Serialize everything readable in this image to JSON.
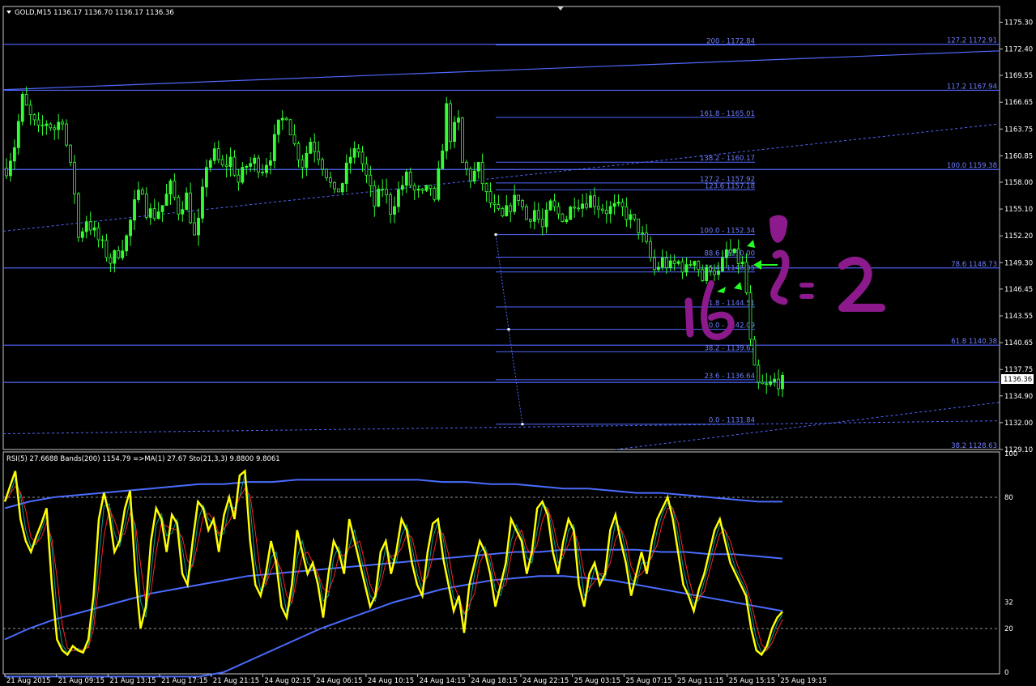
{
  "symbol_header": "GOLD,M15  1136.17 1136.70 1136.17 1136.36",
  "indicator_header": "RSI(5) 27.6688  Bands(200) 1154.79  =>MA(1) 27.67  Sto(21,3,3) 9.8800 9.8061",
  "current_price_label": "1136.36",
  "colors": {
    "background": "#000000",
    "frame": "#c8c8c8",
    "bull_candle": "#33ff33",
    "level_line": "#5068ff",
    "level_text": "#6f7fff",
    "rsi": "#ffff00",
    "stoch_main": "#00a0a0",
    "stoch_signal": "#ff2222",
    "band": "#4a6cff",
    "annotation_purple": "#8c1a8c",
    "arrow_green": "#22ff22"
  },
  "annotations": {
    "ratio_text": "1:2",
    "tp_number": "2",
    "sl_number": "1"
  },
  "chart_data": [
    {
      "type": "candlestick",
      "title": "GOLD,M15",
      "ylim": [
        1129.1,
        1177.0
      ],
      "y_ticks": [
        "1175.30",
        "1172.40",
        "1169.55",
        "1166.65",
        "1163.75",
        "1160.85",
        "1158.00",
        "1155.10",
        "1152.20",
        "1149.30",
        "1146.45",
        "1143.55",
        "1140.65",
        "1137.75",
        "1134.90",
        "1132.00",
        "1129.10"
      ],
      "x_ticks": [
        "21 Aug 2015",
        "21 Aug 09:15",
        "21 Aug 13:15",
        "21 Aug 17:15",
        "21 Aug 21:15",
        "24 Aug 02:15",
        "24 Aug 06:15",
        "24 Aug 10:15",
        "24 Aug 14:15",
        "24 Aug 18:15",
        "24 Aug 22:15",
        "25 Aug 03:15",
        "25 Aug 07:15",
        "25 Aug 11:15",
        "25 Aug 15:15",
        "25 Aug 19:15"
      ],
      "close_path": [
        [
          0,
          1159.5
        ],
        [
          2,
          1162
        ],
        [
          4,
          1167
        ],
        [
          6,
          1165
        ],
        [
          8,
          1163.5
        ],
        [
          10,
          1164.5
        ],
        [
          12,
          1163.8
        ],
        [
          14,
          1165
        ],
        [
          15,
          1162
        ],
        [
          17,
          1157
        ],
        [
          18,
          1152
        ],
        [
          20,
          1154
        ],
        [
          22,
          1152.5
        ],
        [
          24,
          1151
        ],
        [
          26,
          1149.5
        ],
        [
          28,
          1150.5
        ],
        [
          30,
          1152
        ],
        [
          32,
          1155.5
        ],
        [
          34,
          1157.5
        ],
        [
          35,
          1155
        ],
        [
          37,
          1154.5
        ],
        [
          39,
          1155.5
        ],
        [
          41,
          1157.5
        ],
        [
          43,
          1155
        ],
        [
          45,
          1156.5
        ],
        [
          47,
          1152
        ],
        [
          48,
          1153.5
        ],
        [
          50,
          1160
        ],
        [
          52,
          1161
        ],
        [
          54,
          1159.5
        ],
        [
          56,
          1160.5
        ],
        [
          58,
          1158
        ],
        [
          60,
          1159.8
        ],
        [
          62,
          1160.2
        ],
        [
          64,
          1159.5
        ],
        [
          66,
          1161
        ],
        [
          68,
          1164
        ],
        [
          70,
          1165.5
        ],
        [
          72,
          1162
        ],
        [
          74,
          1160
        ],
        [
          76,
          1162.5
        ],
        [
          78,
          1161
        ],
        [
          80,
          1159
        ],
        [
          82,
          1156.5
        ],
        [
          84,
          1158
        ],
        [
          86,
          1160.8
        ],
        [
          88,
          1161.5
        ],
        [
          90,
          1158.5
        ],
        [
          92,
          1155.5
        ],
        [
          94,
          1157.5
        ],
        [
          96,
          1155
        ],
        [
          98,
          1157
        ],
        [
          100,
          1158.5
        ],
        [
          102,
          1157
        ],
        [
          104,
          1156.5
        ],
        [
          106,
          1157.5
        ],
        [
          107,
          1155.5
        ],
        [
          109,
          1162
        ],
        [
          110,
          1166
        ],
        [
          111,
          1163
        ],
        [
          113,
          1164.5
        ],
        [
          114,
          1160
        ],
        [
          116,
          1158.5
        ],
        [
          118,
          1159.5
        ],
        [
          120,
          1156.5
        ],
        [
          122,
          1155
        ],
        [
          124,
          1154
        ],
        [
          126,
          1155.5
        ],
        [
          128,
          1156.5
        ],
        [
          130,
          1154
        ],
        [
          132,
          1155
        ],
        [
          134,
          1153
        ],
        [
          136,
          1155.5
        ],
        [
          138,
          1154.5
        ],
        [
          140,
          1154.2
        ],
        [
          142,
          1156
        ],
        [
          144,
          1155.8
        ],
        [
          146,
          1156.3
        ],
        [
          148,
          1155.5
        ],
        [
          150,
          1155
        ],
        [
          152,
          1155.2
        ],
        [
          154,
          1155
        ],
        [
          156,
          1154
        ],
        [
          158,
          1153
        ],
        [
          160,
          1151
        ],
        [
          162,
          1148.5
        ],
        [
          164,
          1149.5
        ],
        [
          166,
          1148.8
        ],
        [
          168,
          1149.3
        ],
        [
          170,
          1148.5
        ],
        [
          172,
          1150
        ],
        [
          174,
          1147.5
        ],
        [
          176,
          1149
        ],
        [
          178,
          1148
        ],
        [
          180,
          1150.5
        ],
        [
          182,
          1150
        ],
        [
          184,
          1149
        ],
        [
          185,
          1146
        ],
        [
          186,
          1140.5
        ],
        [
          187,
          1137.5
        ],
        [
          188,
          1136
        ],
        [
          190,
          1135.8
        ],
        [
          192,
          1136.5
        ],
        [
          194,
          1136.36
        ]
      ]
    },
    {
      "type": "line",
      "title": "RSI(5) / Bands(200) / Sto(21,3,3)",
      "ylim": [
        0,
        100
      ],
      "y_ticks": [
        "100",
        "80",
        "32",
        "20",
        "0"
      ],
      "levels": [
        80,
        20
      ],
      "series": [
        {
          "name": "RSI(5)",
          "values": [
            78,
            85,
            92,
            70,
            60,
            55,
            62,
            68,
            75,
            40,
            15,
            10,
            8,
            12,
            10,
            9,
            15,
            35,
            70,
            82,
            72,
            55,
            60,
            75,
            83,
            45,
            20,
            30,
            60,
            75,
            70,
            55,
            72,
            68,
            45,
            40,
            60,
            78,
            75,
            65,
            70,
            55,
            72,
            80,
            70,
            90,
            92,
            60,
            40,
            35,
            45,
            60,
            50,
            30,
            25,
            40,
            65,
            55,
            45,
            50,
            40,
            25,
            45,
            60,
            55,
            45,
            70,
            60,
            50,
            40,
            30,
            35,
            55,
            60,
            45,
            55,
            70,
            65,
            50,
            40,
            35,
            55,
            68,
            70,
            52,
            40,
            28,
            35,
            18,
            40,
            50,
            60,
            55,
            45,
            30,
            40,
            50,
            70,
            65,
            60,
            45,
            55,
            75,
            78,
            72,
            55,
            45,
            60,
            70,
            65,
            40,
            30,
            45,
            50,
            40,
            45,
            65,
            72,
            60,
            50,
            35,
            45,
            55,
            45,
            60,
            70,
            75,
            80,
            70,
            55,
            40,
            35,
            28,
            38,
            45,
            55,
            65,
            70,
            60,
            50,
            45,
            40,
            35,
            20,
            10,
            8,
            12,
            20,
            25,
            27.67
          ]
        },
        {
          "name": "Bands upper",
          "values": [
            75,
            78,
            80,
            81,
            82,
            83,
            84,
            85,
            86,
            86,
            87,
            87,
            88,
            88,
            88,
            88,
            88,
            88,
            87,
            87,
            86,
            86,
            85,
            84,
            84,
            83,
            82,
            82,
            81,
            80,
            79,
            78,
            78
          ]
        },
        {
          "name": "Bands middle",
          "values": [
            15,
            20,
            24,
            27,
            30,
            33,
            36,
            38,
            40,
            42,
            44,
            45,
            46,
            47,
            48,
            49,
            50,
            51,
            52,
            53,
            54,
            55,
            55,
            56,
            56,
            56,
            56,
            55,
            55,
            54,
            54,
            53,
            52
          ]
        },
        {
          "name": "Bands lower",
          "values": [
            -40,
            -38,
            -35,
            -30,
            -25,
            -20,
            -15,
            -10,
            -5,
            0,
            5,
            10,
            15,
            20,
            24,
            28,
            32,
            35,
            38,
            40,
            42,
            43,
            44,
            44,
            43,
            42,
            40,
            38,
            36,
            34,
            32,
            30,
            28
          ]
        }
      ]
    }
  ],
  "levels": {
    "h_lines": [
      {
        "price": 1172.91,
        "right_label": "127.2  1172.91"
      },
      {
        "price": 1167.94,
        "right_label": "117.2  1167.94"
      },
      {
        "price": 1159.38,
        "right_label": "100.0   1159.38"
      },
      {
        "price": 1148.73,
        "right_label": "78.6  1148.73"
      },
      {
        "price": 1140.38,
        "right_label": "61.8  1140.38"
      },
      {
        "price": 1136.36,
        "right_label": ""
      }
    ],
    "fib_levels": [
      {
        "price": 1172.84,
        "label": "200 - 1172.84"
      },
      {
        "price": 1165.01,
        "label": "161.8 - 1165.01"
      },
      {
        "price": 1160.17,
        "label": "138.2 - 1160.17"
      },
      {
        "price": 1157.92,
        "label": "127.2 - 1157.92"
      },
      {
        "price": 1157.18,
        "label": "123.6  1157.18"
      },
      {
        "price": 1152.34,
        "label": "100.0 - 1152.34"
      },
      {
        "price": 1149.9,
        "label": "88.6 - 1150.00"
      },
      {
        "price": 1148.3,
        "label": "76.4 - 1148.05"
      },
      {
        "price": 1144.51,
        "label": "61.8 - 1144.51"
      },
      {
        "price": 1142.09,
        "label": "50.0 - 1142.09"
      },
      {
        "price": 1139.67,
        "label": "38.2 - 1139.67"
      },
      {
        "price": 1136.64,
        "label": "23.6 - 1136.64"
      },
      {
        "price": 1131.84,
        "label": "0.0 - 1131.84"
      }
    ],
    "bottom_right_label": "38.2  1128.63"
  }
}
